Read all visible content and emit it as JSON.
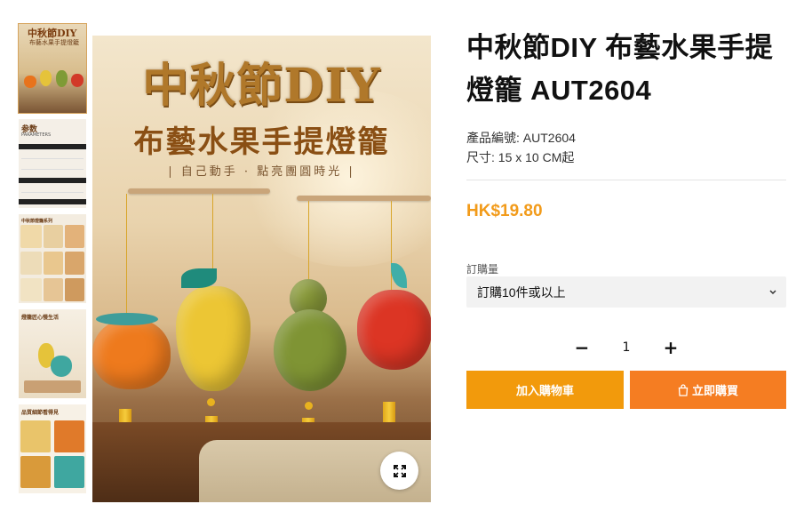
{
  "thumbnails": [
    {
      "title": "中秋節DIY",
      "subtitle": "布藝水果手提燈籠",
      "active": true
    },
    {
      "title": "参数",
      "subtitle": "PARAMETERS"
    },
    {
      "title": "中秋節燈籠系列"
    },
    {
      "title": "燈籠匠心慢生活"
    },
    {
      "title": "品質細節看得見"
    }
  ],
  "hero": {
    "title": "中秋節DIY",
    "subtitle": "布藝水果手提燈籠",
    "tagline": "| 自己動手 · 點亮團圓時光 |"
  },
  "product": {
    "title": "中秋節DIY 布藝水果手提燈籠 AUT2604",
    "sku_line": "產品編號: AUT2604",
    "size_line": "尺寸: 15 x 10 CM起",
    "price": "HK$19.80",
    "quantity_label": "訂購量",
    "quantity_option": "訂購10件或以上",
    "quantity_value": "1",
    "minus_label": "−",
    "plus_label": "+",
    "add_to_cart_label": "加入購物車",
    "buy_now_label": "立即購買"
  },
  "colors": {
    "accent": "#f29a0c",
    "buy": "#f57d22",
    "price": "#f29b1a"
  },
  "icons": [
    "expand-icon",
    "chevron-down-icon",
    "shopping-bag-icon"
  ]
}
